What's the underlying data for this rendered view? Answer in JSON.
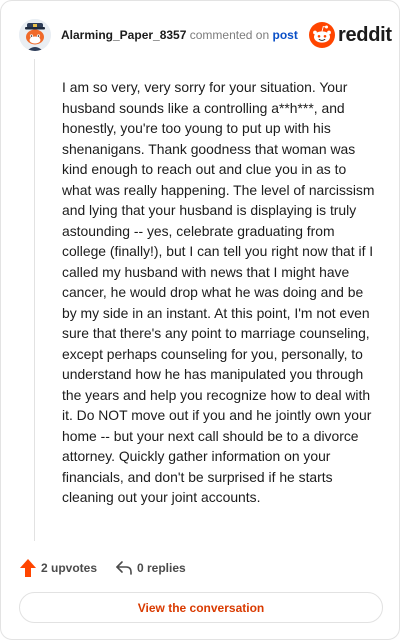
{
  "header": {
    "username": "Alarming_Paper_8357",
    "action_text": "commented on",
    "post_link": "post",
    "brand": "reddit",
    "brand_color": "#ff4500",
    "avatar_icon": "snoo-avatar-icon"
  },
  "comment": {
    "body": "I am so very, very sorry for your situation. Your husband sounds like a controlling a**h***, and honestly, you're too young to put up with his shenanigans. Thank goodness that woman was kind enough to reach out and clue you in as to what was really happening. The level of narcissism and lying that your husband is displaying is truly astounding -- yes, celebrate graduating from college (finally!), but I can tell you right now that if I called my husband with news that I might have cancer, he would drop what he was doing and be by my side in an instant. At this point, I'm not even sure that there's any point to marriage counseling, except perhaps counseling for you, personally, to understand how he has manipulated you through the years and help you recognize how to deal with it. Do NOT move out if you and he jointly own your home -- but your next call should be to a divorce attorney. Quickly gather information on your financials, and don't be surprised if he starts cleaning out your joint accounts."
  },
  "actions": {
    "upvotes": "2 upvotes",
    "replies": "0 replies",
    "upvote_color": "#ff4500"
  },
  "cta": {
    "label": "View the conversation",
    "color": "#d93a00"
  }
}
